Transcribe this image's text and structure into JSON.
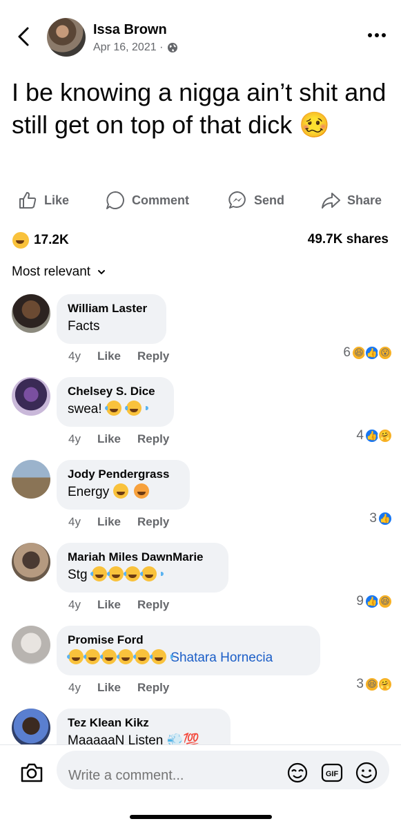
{
  "post": {
    "author": "Issa Brown",
    "date": "Apr 16, 2021 ·",
    "text": "I be knowing a nigga ain’t shit and still get on top of that dick 🥴"
  },
  "actions": {
    "like": "Like",
    "comment": "Comment",
    "send": "Send",
    "share": "Share"
  },
  "stats": {
    "reactions": "17.2K",
    "shares": "49.7K shares"
  },
  "sort_label": "Most relevant",
  "comment_actions": {
    "time": "4y",
    "like": "Like",
    "reply": "Reply"
  },
  "comments": [
    {
      "name": "William Laster",
      "text": "Facts",
      "count": "6",
      "reactions": [
        "haha",
        "like",
        "wow"
      ]
    },
    {
      "name": "Chelsey S. Dice",
      "text": "swea!",
      "count": "4",
      "reactions": [
        "like",
        "care"
      ]
    },
    {
      "name": "Jody Pendergrass",
      "text": "Energy",
      "count": "3",
      "reactions": [
        "like"
      ]
    },
    {
      "name": "Mariah Miles DawnMarie",
      "text": "Stg",
      "count": "9",
      "reactions": [
        "like",
        "haha"
      ]
    },
    {
      "name": "Promise Ford",
      "text": "",
      "mention": "Shatara Hornecia",
      "count": "3",
      "reactions": [
        "haha",
        "care"
      ]
    },
    {
      "name": "Tez Klean Kikz",
      "text": "MaaaaaN Listen 💨💯"
    }
  ],
  "composer": {
    "placeholder": "Write a comment..."
  },
  "colors": {
    "accent": "#1877f2",
    "secondary_text": "#65676b",
    "bubble": "#f0f2f5"
  }
}
